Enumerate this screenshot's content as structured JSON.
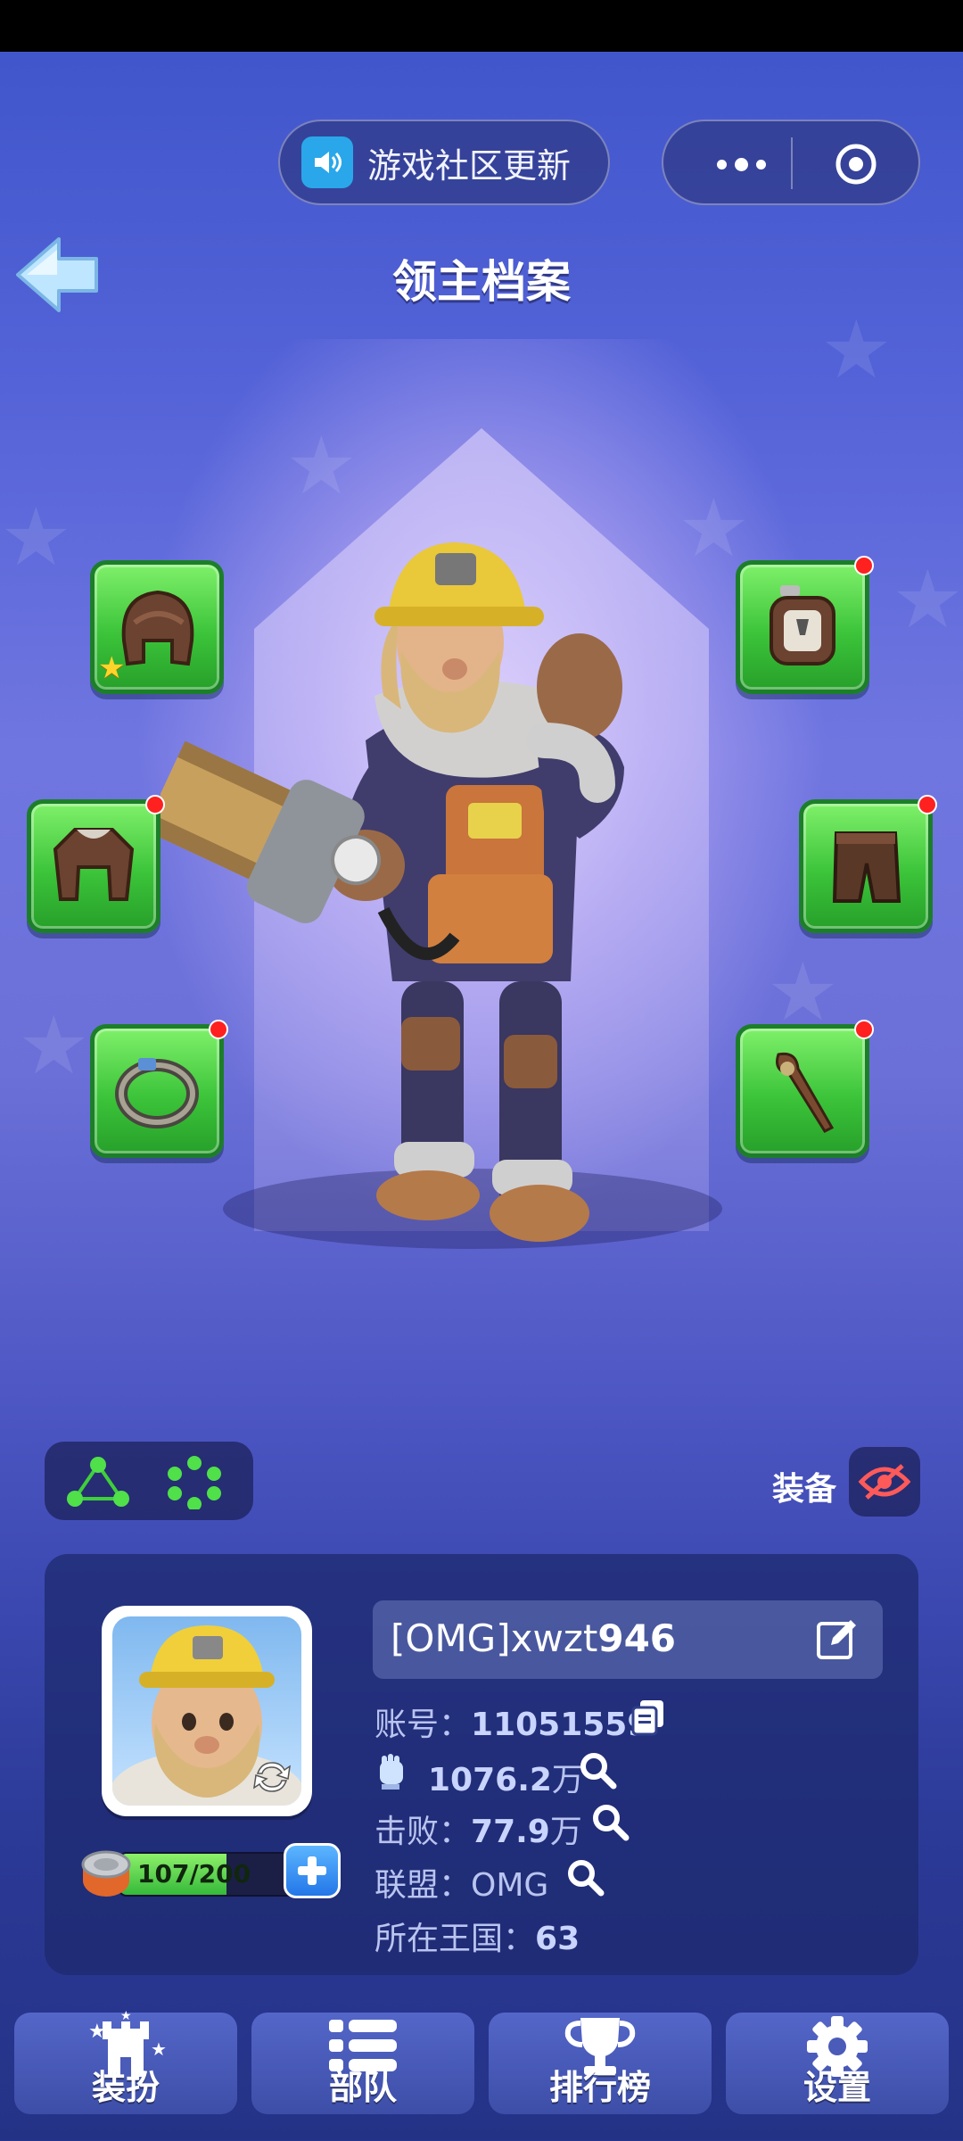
{
  "top_bar": {
    "news_label": "游戏社区更新"
  },
  "header": {
    "title": "领主档案"
  },
  "gear": {
    "slots": [
      {
        "name": "helmet",
        "icon": "fur-hat-icon",
        "red_dot": false,
        "starred": true
      },
      {
        "name": "jacket",
        "icon": "jacket-icon",
        "red_dot": true,
        "starred": false
      },
      {
        "name": "ring",
        "icon": "ring-icon",
        "red_dot": true,
        "starred": false
      },
      {
        "name": "amulet",
        "icon": "amulet-icon",
        "red_dot": true,
        "starred": false
      },
      {
        "name": "pants",
        "icon": "pants-icon",
        "red_dot": true,
        "starred": false
      },
      {
        "name": "weapon",
        "icon": "staff-icon",
        "red_dot": true,
        "starred": false
      }
    ]
  },
  "equip": {
    "label": "装备"
  },
  "profile": {
    "name_prefix": "[OMG]xwzt",
    "name_suffix": "946",
    "account_label": "账号：",
    "account_value": "11051559",
    "power_value": "1076.2",
    "power_unit": "万",
    "defeat_label": "击败：",
    "defeat_value": "77.9",
    "defeat_unit": "万",
    "alliance_label": "联盟：",
    "alliance_value": "OMG",
    "kingdom_label": "所在王国：",
    "kingdom_value": "63",
    "energy_text": "107/200",
    "energy_fraction": 0.535
  },
  "nav": {
    "items": [
      {
        "label": "装扮",
        "icon": "castle-icon"
      },
      {
        "label": "部队",
        "icon": "list-icon"
      },
      {
        "label": "排行榜",
        "icon": "trophy-icon"
      },
      {
        "label": "设置",
        "icon": "gear-icon"
      }
    ]
  },
  "colors": {
    "slot_green": "#3cc43a",
    "red_dot": "#ff2020",
    "accent_blue": "#2376e8"
  }
}
